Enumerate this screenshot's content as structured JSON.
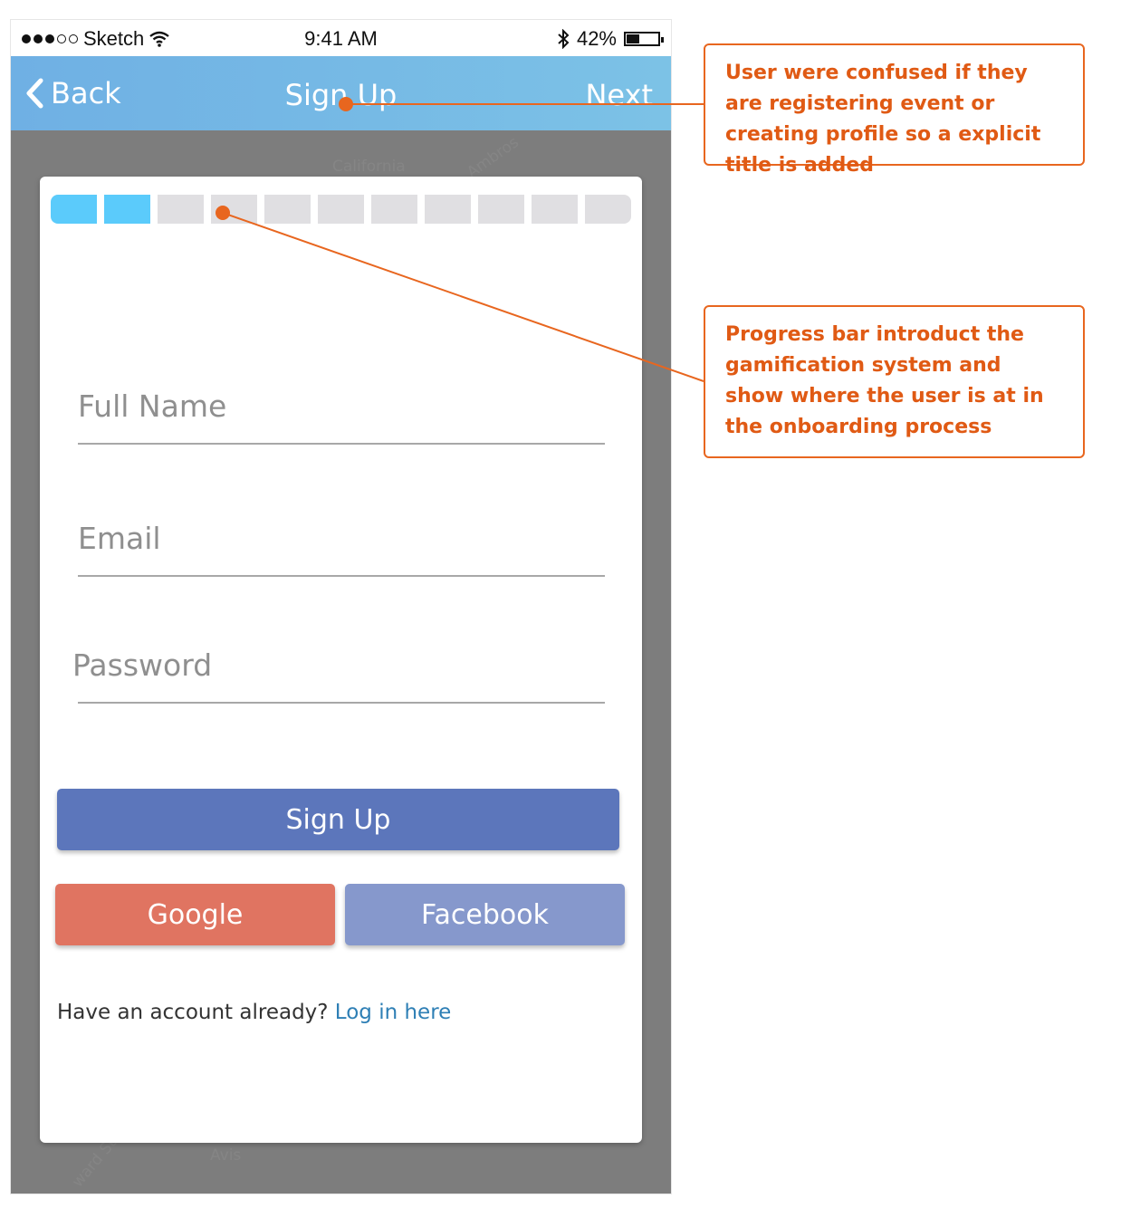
{
  "statusbar": {
    "carrier": "Sketch",
    "time": "9:41 AM",
    "battery_percent": "42%",
    "battery_level": 0.42,
    "signal_bars_filled": 3,
    "signal_bars_total": 5
  },
  "navbar": {
    "back_label": "Back",
    "title": "Sign Up",
    "next_label": "Next"
  },
  "progress": {
    "completed_steps": 2,
    "total_steps": 11,
    "done_color": "#5bcbfb",
    "todo_color": "#e0dfe2"
  },
  "form": {
    "full_name_placeholder": "Full Name",
    "email_placeholder": "Email",
    "password_placeholder": "Password"
  },
  "buttons": {
    "signup_label": "Sign Up",
    "google_label": "Google",
    "facebook_label": "Facebook"
  },
  "login": {
    "prompt": "Have an account already?",
    "link_label": "Log in here"
  },
  "map_labels": [
    "California",
    "Ambros",
    "Avis",
    "ward St"
  ],
  "annotations": [
    {
      "text": "User were confused if they are registering event or creating profile so a explicit title is added"
    },
    {
      "text": "Progress bar introduct the gamification system and show where the user is at in the onboarding process"
    }
  ],
  "colors": {
    "accent_annotation": "#e8661f",
    "navbar": "#74b8e5",
    "signup_button": "#5c76bb",
    "google_button": "#e07461",
    "facebook_button": "#8698cc"
  }
}
